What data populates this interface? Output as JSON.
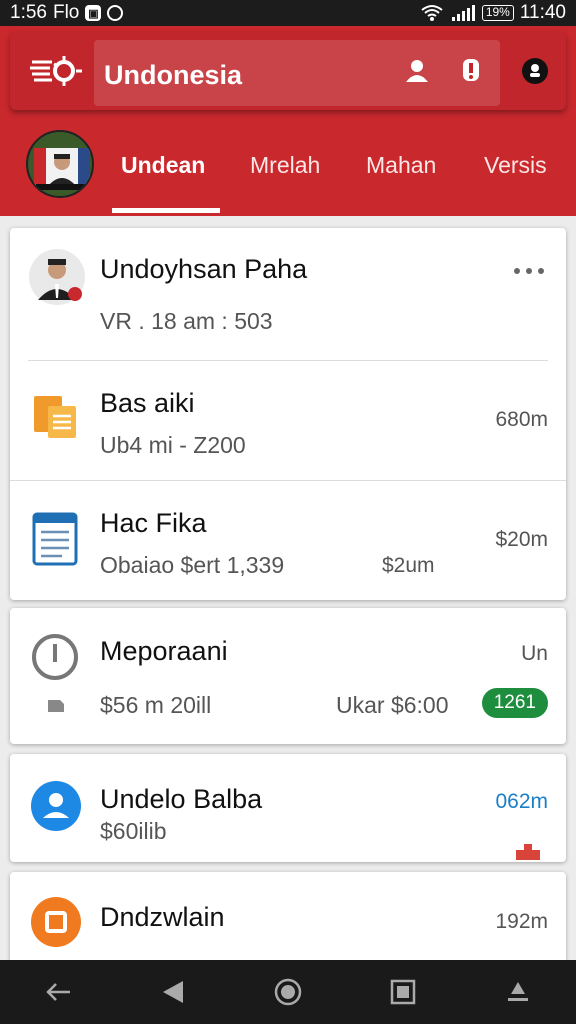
{
  "status_bar": {
    "time_left": "1:56",
    "app_label": "Flo",
    "battery": "19%",
    "clock": "11:40"
  },
  "header": {
    "title": "Undonesia",
    "tabs": [
      {
        "label": "Undean",
        "active": true
      },
      {
        "label": "Mrelah",
        "active": false
      },
      {
        "label": "Mahan",
        "active": false
      },
      {
        "label": "Versis",
        "active": false
      }
    ]
  },
  "cards": {
    "first": {
      "profile": {
        "name": "Undoyhsan Paha",
        "meta": "VR . 18 am : 503"
      },
      "items": [
        {
          "title": "Bas aiki",
          "subtitle": "Ub4 mi - Z200",
          "amount": "680m"
        },
        {
          "title": "Hac Fika",
          "subtitle": "Obaiao  $ert 1,339",
          "amount_mid": "$2um",
          "amount": "$20m"
        }
      ]
    },
    "second": {
      "title": "Meporaani",
      "amount": "Un",
      "subtitle": "$56 m  20ill",
      "amount_mid": "Ukar $6:00",
      "badge": "1261"
    },
    "third": {
      "title": "Undelo Balba",
      "subtitle": "$60ilib",
      "amount": "062m"
    },
    "fourth": {
      "title": "Dndzwlain",
      "amount": "192m"
    }
  },
  "colors": {
    "brand": "#c9282d",
    "accent_green": "#1e8e3e",
    "accent_blue": "#1a7fc8"
  }
}
